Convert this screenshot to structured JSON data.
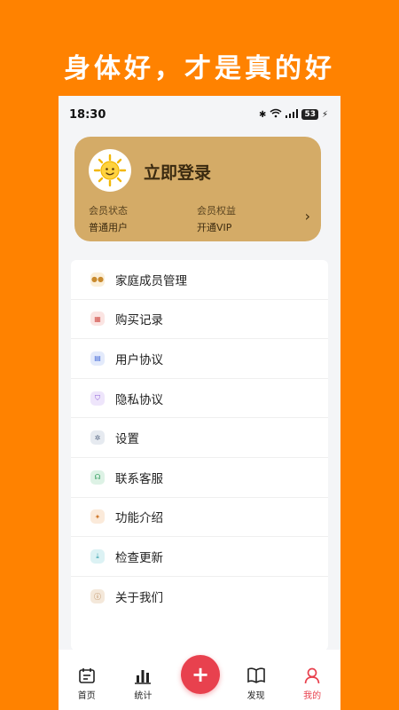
{
  "banner": "身体好，才是真的好",
  "status": {
    "time": "18:30",
    "battery": "53"
  },
  "login": {
    "title": "立即登录",
    "member_status_label": "会员状态",
    "member_status_value": "普通用户",
    "member_rights_label": "会员权益",
    "member_rights_value": "开通VIP",
    "arrow": "›"
  },
  "menu": [
    {
      "label": "家庭成员管理",
      "icon": "family-icon",
      "color": "#C98A2E",
      "bg": "#FBEFD9"
    },
    {
      "label": "购买记录",
      "icon": "calendar-icon",
      "color": "#D2554F",
      "bg": "#FBE4E2"
    },
    {
      "label": "用户协议",
      "icon": "document-icon",
      "color": "#4A6FD8",
      "bg": "#E3EAFB"
    },
    {
      "label": "隐私协议",
      "icon": "shield-icon",
      "color": "#8A5BD6",
      "bg": "#EEE5FB"
    },
    {
      "label": "设置",
      "icon": "gear-icon",
      "color": "#5B6B86",
      "bg": "#E6EAF0"
    },
    {
      "label": "联系客服",
      "icon": "headset-icon",
      "color": "#2E9A5A",
      "bg": "#DDF2E5"
    },
    {
      "label": "功能介绍",
      "icon": "star-icon",
      "color": "#D07A2E",
      "bg": "#FBEADA"
    },
    {
      "label": "检查更新",
      "icon": "download-icon",
      "color": "#2A9AA8",
      "bg": "#DCF2F4"
    },
    {
      "label": "关于我们",
      "icon": "info-icon",
      "color": "#A8703A",
      "bg": "#F4E8DA"
    }
  ],
  "tabs": [
    {
      "label": "首页",
      "icon": "home-icon"
    },
    {
      "label": "统计",
      "icon": "bar-chart-icon"
    },
    {
      "label": "发现",
      "icon": "book-icon"
    },
    {
      "label": "我的",
      "icon": "user-icon"
    }
  ],
  "add_label": "+",
  "colors": {
    "accent": "#E8414E",
    "card": "#D4AB67",
    "background": "#FF8200"
  }
}
